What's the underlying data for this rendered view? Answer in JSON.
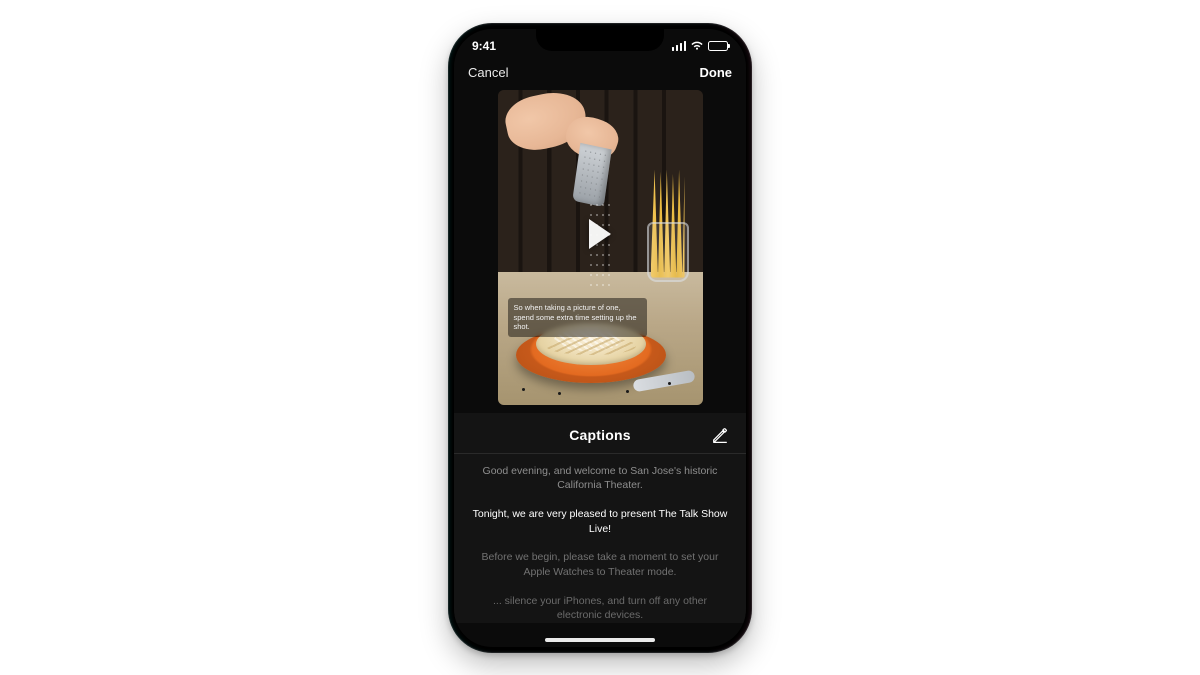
{
  "status": {
    "time": "9:41"
  },
  "nav": {
    "cancel": "Cancel",
    "done": "Done"
  },
  "preview": {
    "overlay_caption": "So when taking a picture of one, spend some extra time setting up the shot."
  },
  "captions": {
    "heading": "Captions",
    "lines": [
      {
        "text": "Good evening, and welcome to San Jose's historic California Theater.",
        "state": "dim"
      },
      {
        "text": "Tonight, we are very pleased to present The Talk Show Live!",
        "state": "active"
      },
      {
        "text": "Before we begin, please take a moment to set your Apple Watches to Theater mode.",
        "state": "faded"
      },
      {
        "text": "... silence your iPhones, and turn off any other electronic devices.",
        "state": "faded-more"
      }
    ]
  }
}
